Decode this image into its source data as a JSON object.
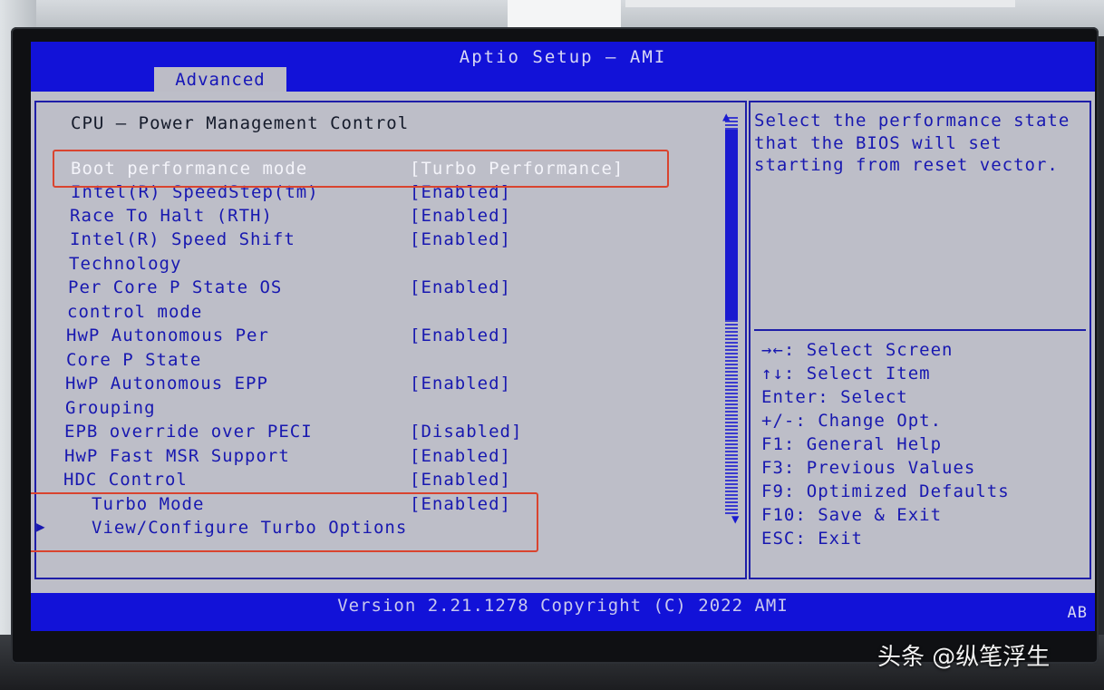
{
  "header": {
    "title": "Aptio Setup – AMI",
    "active_tab": "Advanced"
  },
  "page": {
    "section_title": "CPU – Power Management Control"
  },
  "settings": [
    {
      "label": "Boot performance mode",
      "value": "[Turbo Performance]"
    },
    {
      "label": "Intel(R) SpeedStep(tm)",
      "value": "[Enabled]"
    },
    {
      "label": "Race To Halt (RTH)",
      "value": "[Enabled]"
    },
    {
      "label": "Intel(R) Speed Shift",
      "label2": "Technology",
      "value": "[Enabled]"
    },
    {
      "label": "Per Core P State OS",
      "label2": "control mode",
      "value": "[Enabled]"
    },
    {
      "label": "HwP Autonomous Per",
      "label2": "Core P State",
      "value": "[Enabled]"
    },
    {
      "label": "HwP Autonomous EPP",
      "label2": "Grouping",
      "value": "[Enabled]"
    },
    {
      "label": "EPB override over PECI",
      "value": "[Disabled]"
    },
    {
      "label": "HwP Fast MSR Support",
      "value": "[Enabled]"
    },
    {
      "label": "HDC Control",
      "value": "[Enabled]"
    },
    {
      "label": "Turbo Mode",
      "value": "[Enabled]"
    },
    {
      "label": "View/Configure Turbo Options",
      "value": ""
    }
  ],
  "help": {
    "description": "Select the performance state that the BIOS will set starting from reset vector.",
    "keys": [
      "→←: Select Screen",
      "↑↓: Select Item",
      "Enter: Select",
      "+/-: Change Opt.",
      "F1: General Help",
      "F3: Previous Values",
      "F9: Optimized Defaults",
      "F10: Save & Exit",
      "ESC: Exit"
    ]
  },
  "footer": {
    "version": "Version 2.21.1278 Copyright (C) 2022 AMI",
    "badge": "AB"
  },
  "watermark": "头条 @纵笔浮生",
  "colors": {
    "background": "#1212d8",
    "panel": "#bdbec8",
    "text": "#1818b0",
    "highlight_box": "#d9442f"
  }
}
